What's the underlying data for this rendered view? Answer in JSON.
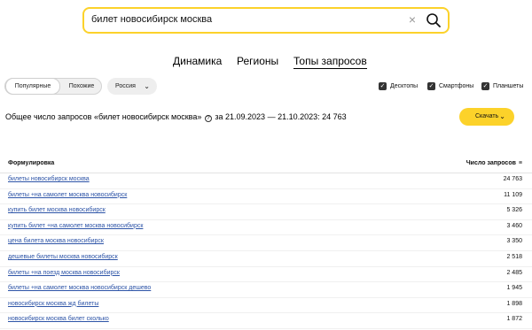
{
  "search": {
    "value": "билет новосибирск москва",
    "clear_symbol": "×"
  },
  "tabs": [
    {
      "label": "Динамика"
    },
    {
      "label": "Регионы"
    },
    {
      "label": "Топы запросов"
    }
  ],
  "active_tab": "Топы запросов",
  "filters": {
    "segment": {
      "active": "Популярные",
      "inactive": "Похожие"
    },
    "region": {
      "label": "Россия"
    },
    "devices": [
      {
        "label": "Десктопы",
        "checked": true
      },
      {
        "label": "Смартфоны",
        "checked": true
      },
      {
        "label": "Планшеты",
        "checked": true
      }
    ]
  },
  "summary": {
    "prefix": "Общее число запросов «билет новосибирск москва»",
    "help": "?",
    "suffix": "за 21.09.2023 — 21.10.2023: 24 763"
  },
  "download": {
    "label": "Скачать"
  },
  "table": {
    "col_query": "Формулировка",
    "col_count": "Число запросов",
    "rows": [
      {
        "query": "билеты новосибирск москва",
        "count": "24 763"
      },
      {
        "query": "билеты +на самолет москва новосибирск",
        "count": "11 109"
      },
      {
        "query": "купить билет москва новосибирск",
        "count": "5 326"
      },
      {
        "query": "купить билет +на самолет москва новосибирск",
        "count": "3 460"
      },
      {
        "query": "цена билета москва новосибирск",
        "count": "3 350"
      },
      {
        "query": "дешевые билеты москва новосибирск",
        "count": "2 518"
      },
      {
        "query": "билеты +на поезд москва новосибирск",
        "count": "2 485"
      },
      {
        "query": "билеты +на самолет москва новосибирск дешево",
        "count": "1 945"
      },
      {
        "query": "новосибирск москва жд билеты",
        "count": "1 898"
      },
      {
        "query": "новосибирск москва билет сколько",
        "count": "1 872"
      }
    ]
  },
  "colors": {
    "accent": "#fcd22a",
    "link": "#2d54a7"
  }
}
